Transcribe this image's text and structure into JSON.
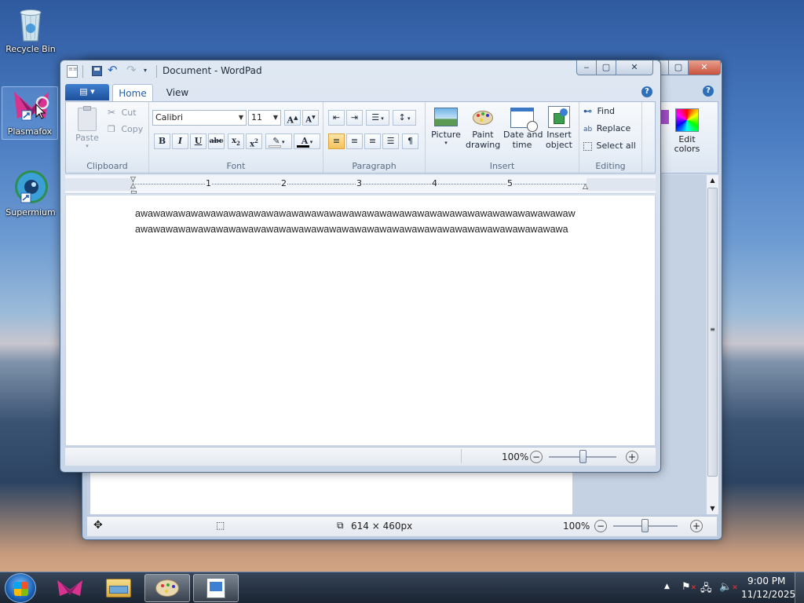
{
  "desktop": {
    "icons": [
      {
        "label": "Recycle Bin"
      },
      {
        "label": "Plasmafox"
      },
      {
        "label": "Supermium"
      }
    ]
  },
  "paint": {
    "title": "",
    "edit_colors": "Edit\ncolors",
    "status": {
      "dimensions": "614 × 460px",
      "zoom": "100%"
    }
  },
  "wordpad": {
    "title": "Document - WordPad",
    "tabs": [
      {
        "label": "Home"
      },
      {
        "label": "View"
      }
    ],
    "clipboard": {
      "paste": "Paste",
      "cut": "Cut",
      "copy": "Copy",
      "label": "Clipboard"
    },
    "font": {
      "family": "Calibri",
      "size": "11",
      "label": "Font"
    },
    "paragraph": {
      "label": "Paragraph"
    },
    "insert": {
      "picture": "Picture",
      "paint": "Paint\ndrawing",
      "datetime": "Date and\ntime",
      "object": "Insert\nobject",
      "label": "Insert"
    },
    "editing": {
      "find": "Find",
      "replace": "Replace",
      "select_all": "Select all",
      "label": "Editing"
    },
    "ruler_numbers": [
      "1",
      "2",
      "3",
      "4",
      "5"
    ],
    "document_lines": [
      "awawawawawawawawawawawawawawawawawawawawawawawawawawawawawawawawawawaw",
      "awawawawawawawawawawawawawawawawawawawawawawawawawawawawawawawawawawa"
    ],
    "status": {
      "zoom": "100%"
    }
  },
  "taskbar": {
    "time": "9:00 PM",
    "date": "11/12/2025"
  },
  "colors": {
    "accent": "#1f5fae",
    "tab_active_bg": "#ffffff",
    "selected_button": "#f8d28a"
  }
}
